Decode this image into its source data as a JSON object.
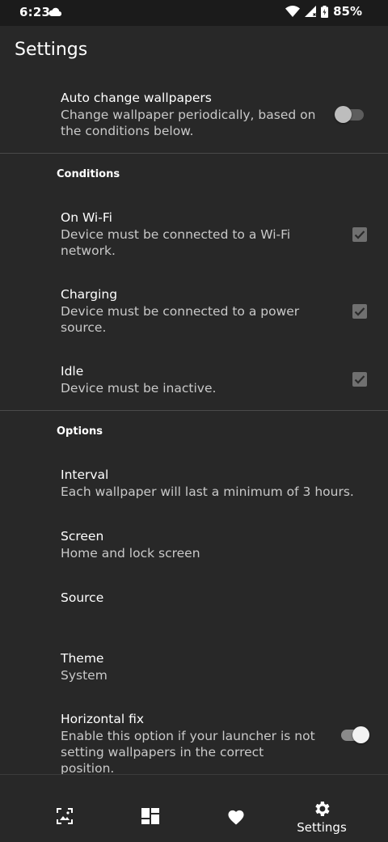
{
  "status_bar": {
    "time": "6:23",
    "battery_percent": "85%",
    "icons": [
      "cloud-icon",
      "wifi-icon",
      "signal-icon",
      "battery-charging-icon"
    ]
  },
  "header": {
    "title": "Settings"
  },
  "auto_change": {
    "title": "Auto change wallpapers",
    "summary": "Change wallpaper periodically, based on the conditions below.",
    "enabled": false
  },
  "conditions": {
    "header": "Conditions",
    "items": [
      {
        "title": "On Wi-Fi",
        "summary": "Device must be connected to a Wi-Fi network.",
        "checked": true
      },
      {
        "title": "Charging",
        "summary": "Device must be connected to a power source.",
        "checked": true
      },
      {
        "title": "Idle",
        "summary": "Device must be inactive.",
        "checked": true
      }
    ]
  },
  "options": {
    "header": "Options",
    "interval": {
      "title": "Interval",
      "summary": "Each wallpaper will last a minimum of 3 hours."
    },
    "screen": {
      "title": "Screen",
      "summary": "Home and lock screen"
    },
    "source": {
      "title": "Source"
    },
    "theme": {
      "title": "Theme",
      "summary": "System"
    },
    "horizontal_fix": {
      "title": "Horizontal fix",
      "summary": "Enable this option if your launcher is not setting wallpapers in the correct position.",
      "enabled": true
    }
  },
  "bottom_nav": {
    "items": [
      {
        "icon": "wallpaper-icon",
        "label": ""
      },
      {
        "icon": "dashboard-icon",
        "label": ""
      },
      {
        "icon": "heart-icon",
        "label": ""
      },
      {
        "icon": "gear-icon",
        "label": "Settings"
      }
    ],
    "selected": "Settings"
  },
  "colors": {
    "background": "#282828",
    "status_bar": "#1b1b1b",
    "divider": "#4a4a4a",
    "text_primary": "#ffffff",
    "text_secondary": "#c9c9c9"
  }
}
